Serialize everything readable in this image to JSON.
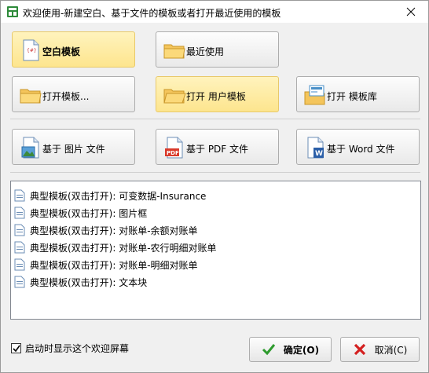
{
  "window": {
    "title": "欢迎使用-新建空白、基于文件的模板或者打开最近使用的模板"
  },
  "buttons": {
    "blank_template": "空白模板",
    "recent": "最近使用",
    "open_template": "打开模板...",
    "open_user_template": "打开 用户模板",
    "open_library": "打开 模板库",
    "from_image": "基于 图片 文件",
    "from_pdf": "基于 PDF 文件",
    "from_word": "基于 Word 文件"
  },
  "templates": [
    "典型模板(双击打开): 可变数据-Insurance",
    "典型模板(双击打开): 图片框",
    "典型模板(双击打开): 对账单-余额对账单",
    "典型模板(双击打开): 对账单-农行明细对账单",
    "典型模板(双击打开): 对账单-明细对账单",
    "典型模板(双击打开): 文本块"
  ],
  "footer": {
    "show_on_startup": "启动时显示这个欢迎屏幕",
    "show_on_startup_checked": true,
    "ok": "确定(O)",
    "cancel": "取消(C)"
  },
  "icons": {
    "app": "template-app-icon",
    "close": "close-icon",
    "blank": "blank-document-icon",
    "folder": "folder-icon",
    "library": "template-library-icon",
    "image": "image-file-icon",
    "pdf": "pdf-file-icon",
    "word": "word-file-icon",
    "check": "green-check-icon",
    "cancel": "red-x-icon"
  },
  "colors": {
    "highlight": "#fde58e",
    "list_bg": "#ffffff",
    "window_bg": "#f0f0f0"
  }
}
